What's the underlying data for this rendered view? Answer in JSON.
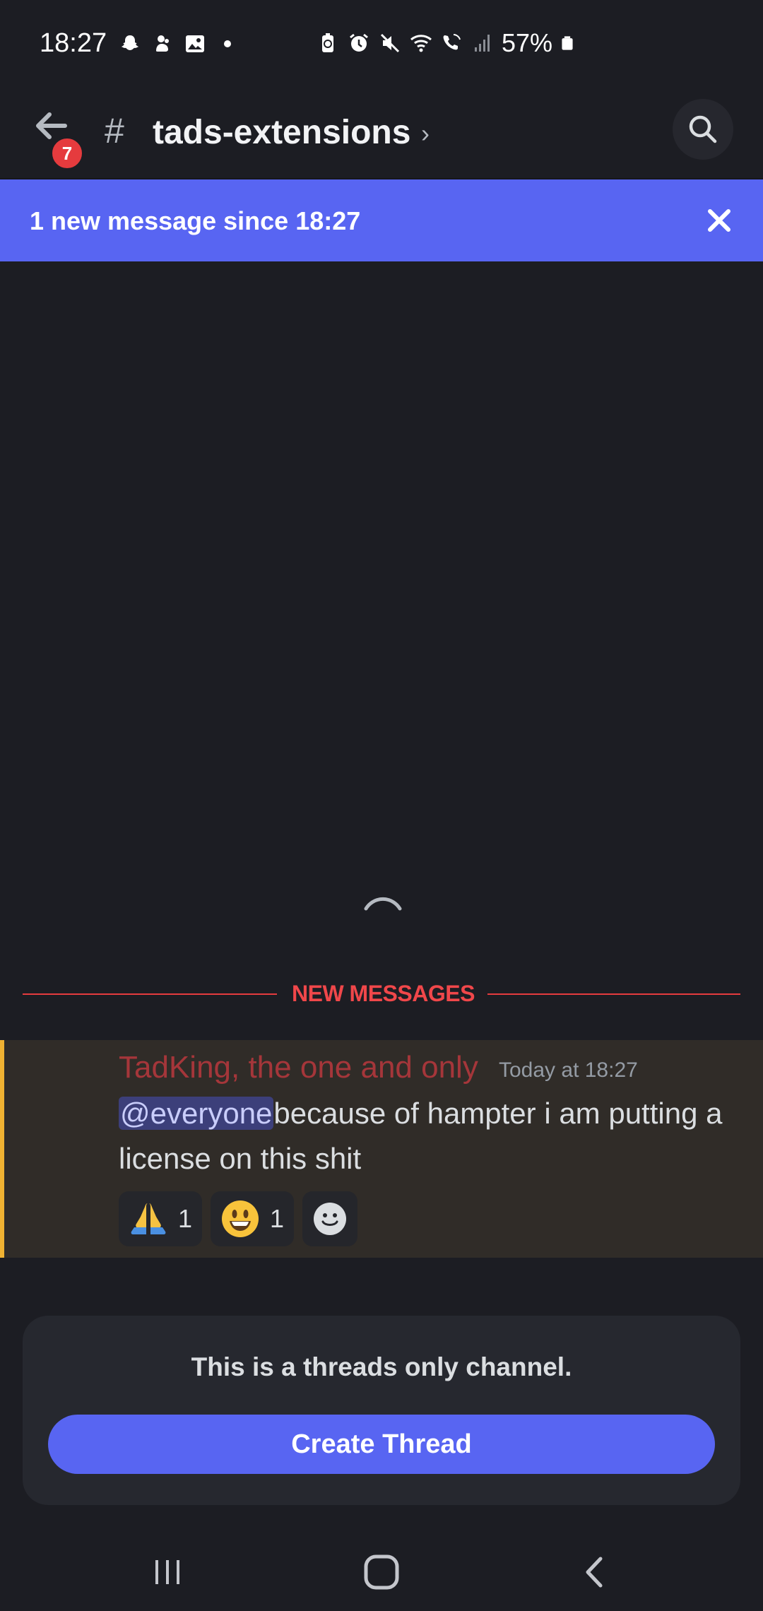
{
  "status_bar": {
    "time": "18:27",
    "battery_text": "57%",
    "left_icons": [
      "snapchat-icon",
      "app-notification-icon",
      "gallery-icon",
      "dot-icon"
    ],
    "right_icons": [
      "battery-saver-icon",
      "alarm-icon",
      "mute-icon",
      "wifi-icon",
      "wifi-call-icon",
      "signal-icon",
      "battery-icon"
    ]
  },
  "header": {
    "back_badge": "7",
    "hash": "#",
    "channel_name": "tads-extensions",
    "chevron": "›"
  },
  "banner": {
    "text": "1 new message since 18:27"
  },
  "divider": {
    "label": "NEW MESSAGES"
  },
  "message": {
    "author": "TadKing, the one and only",
    "timestamp": "Today at 18:27",
    "mention": "@everyone",
    "body": "because of hampter i am putting a license on this shit",
    "reactions": [
      {
        "emoji": "folded-hands-icon",
        "count": "1"
      },
      {
        "emoji": "smiley-icon",
        "count": "1"
      }
    ]
  },
  "threads_card": {
    "text": "This is a threads only channel.",
    "button_label": "Create Thread"
  },
  "colors": {
    "background": "#1c1d23",
    "brand": "#5865f2",
    "danger": "#e53b3e",
    "highlight_border": "#f0b232",
    "author": "#a5363a"
  }
}
